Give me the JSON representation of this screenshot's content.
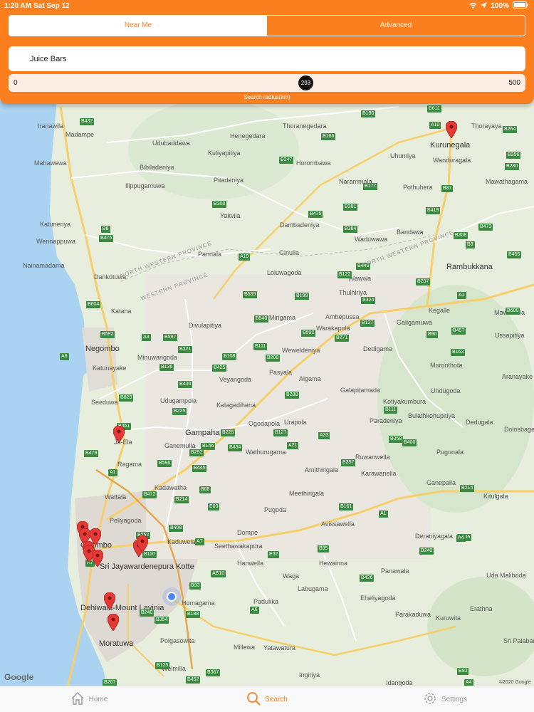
{
  "status": {
    "time": "1:20 AM",
    "date": "Sat Sep 12",
    "battery": "100%",
    "icons": [
      "wifi-icon",
      "location-arrow-icon",
      "battery-icon"
    ]
  },
  "header": {
    "segments": [
      "Near Me",
      "Advanced"
    ],
    "active_segment": "Near Me",
    "search_value": "Juice Bars",
    "slider": {
      "min": "0",
      "max": "500",
      "value": "293",
      "caption": "Search radius(km)"
    },
    "accent": "#fb7f1f"
  },
  "map": {
    "google": "Google",
    "copyright": "©2020 Google",
    "towns": [
      "Iranawila",
      "Madampe",
      "Henegedara",
      "Thoranegedara",
      "Kurunegala",
      "Thorayaya",
      "Mahawewa",
      "Udubaddawa",
      "Kuliyapitiya",
      "Horombawa",
      "Uhumiya",
      "Wanduragala",
      "Bibiladeniya",
      "Pitadeniya",
      "Narammala",
      "Pothuhera",
      "Mawathagama",
      "Ilippugamuwa",
      "Katuneriya",
      "Yakvila",
      "Dambadeniya",
      "Bandawa",
      "Wennappuwa",
      "Waduwawa",
      "Nainamadama",
      "Pannala",
      "Giriulla",
      "Rambukkana",
      "Dankotuwa",
      "Loluwagoda",
      "Alawwa",
      "Katana",
      "Mirigama",
      "Thulhiriya",
      "Kegalle",
      "Mawanella",
      "Ambepussa",
      "Galigamuwa",
      "Divulapitiya",
      "Warakapola",
      "Ussapitiya",
      "Negombo",
      "Minuwangoda",
      "Weweldeniya",
      "Dedigama",
      "Katunayake",
      "Moronthota",
      "Veyangoda",
      "Pasyala",
      "Aranayake",
      "Algama",
      "Seeduwa",
      "Udugampola",
      "Galapitamada",
      "Kotiyakumbura",
      "Undugoda",
      "Kalagedihena",
      "Bulathkohupitiya",
      "Ogodapola",
      "Urapola",
      "Paradeniya",
      "Dedugala",
      "Gampaha",
      "Ja-Ela",
      "Ganemulla",
      "Wathurugama",
      "Dolosbage",
      "Pugunala",
      "Ruwanwella",
      "Ragama",
      "Amithirigala",
      "Karawanella",
      "Ganepalla",
      "Kadawatha",
      "Meethirigala",
      "Wattala",
      "Kitulgala",
      "Pugoda",
      "Peliyagoda",
      "Avissawella",
      "Dompe",
      "Deraniyagala",
      "Colombo",
      "Kaduwela",
      "Seethawakapura",
      "Sri Jayawardenepura Kotte",
      "Hanwella",
      "Hewainna",
      "Panawala",
      "Uda Maliboda",
      "Waga",
      "Labugama",
      "Eheliyagoda",
      "Erathna",
      "Homagama",
      "Dehiwala-Mount Lavinia",
      "Padukka",
      "Parakaduwa",
      "Kuruwita",
      "Moratuwa",
      "Polgasowita",
      "Yatawatura",
      "Sri Palabaddala",
      "Millewa",
      "Welmilla",
      "Ingiriya",
      "Idangoda"
    ],
    "provinces": [
      "NORTH WESTERN PROVINCE",
      "WESTERN PROVINCE",
      "NORTH WESTERN PROVINCE"
    ],
    "roads": [
      "B432",
      "B190",
      "B611",
      "A10",
      "B264",
      "B166",
      "B280",
      "B247",
      "B177",
      "B87",
      "B356",
      "B308",
      "B475",
      "B281",
      "B419",
      "B473",
      "B8",
      "B475",
      "B384",
      "B308",
      "B9",
      "A19",
      "B122",
      "B237",
      "B456",
      "B539",
      "B199",
      "B324",
      "A1",
      "B540",
      "B127",
      "B600",
      "B592",
      "B271",
      "B90",
      "B457",
      "B604",
      "B592",
      "A3",
      "B597",
      "B321",
      "B108",
      "B111",
      "B443",
      "B163",
      "A6",
      "B136",
      "B425",
      "B208",
      "B430",
      "B829",
      "B288",
      "B225",
      "B111",
      "B400",
      "B361",
      "B225",
      "B127",
      "B358",
      "A33",
      "B479",
      "B434",
      "A21",
      "B357",
      "B596",
      "B292",
      "B146",
      "B445",
      "B68",
      "A1",
      "B214",
      "B472",
      "B161",
      "B214",
      "E03",
      "B262",
      "A1",
      "B408",
      "A7",
      "B95",
      "B435",
      "A7",
      "B110",
      "E02",
      "AB10",
      "B426",
      "B93",
      "A6",
      "B240",
      "B188",
      "B354",
      "A4",
      "B240",
      "B125",
      "B367",
      "B452",
      "B267",
      "B93",
      "A4",
      "B225",
      "B84",
      "E01",
      "B419",
      "B93",
      "B535"
    ],
    "pin_color": "#e53935",
    "location_color": "#4a87f0"
  },
  "tabs": [
    {
      "label": "Home",
      "icon": "home-icon"
    },
    {
      "label": "Search",
      "icon": "search-icon"
    },
    {
      "label": "Settings",
      "icon": "gear-icon"
    }
  ],
  "active_tab": "Search"
}
